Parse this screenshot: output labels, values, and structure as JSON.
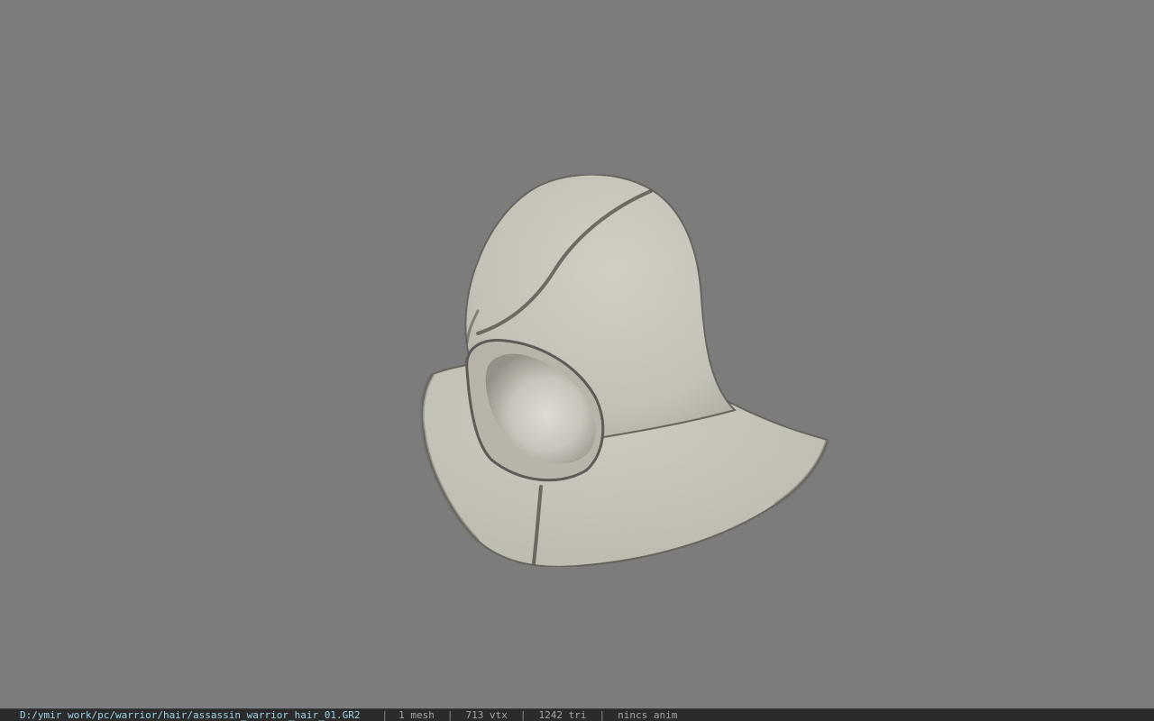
{
  "viewport": {
    "background_color": "#7c7c7c",
    "model": {
      "icon": "hood-mesh",
      "cloth_color": "#c7c4b8",
      "seam_color": "#4e4c46",
      "inner_color": "#bdbab0"
    }
  },
  "status": {
    "path": "D:/ymir work/pc/warrior/hair/assassin_warrior_hair_01.GR2",
    "separator": "|",
    "mesh": "1 mesh",
    "vertices": "713 vtx",
    "triangles": "1242 tri",
    "anim": "nincs anim"
  }
}
